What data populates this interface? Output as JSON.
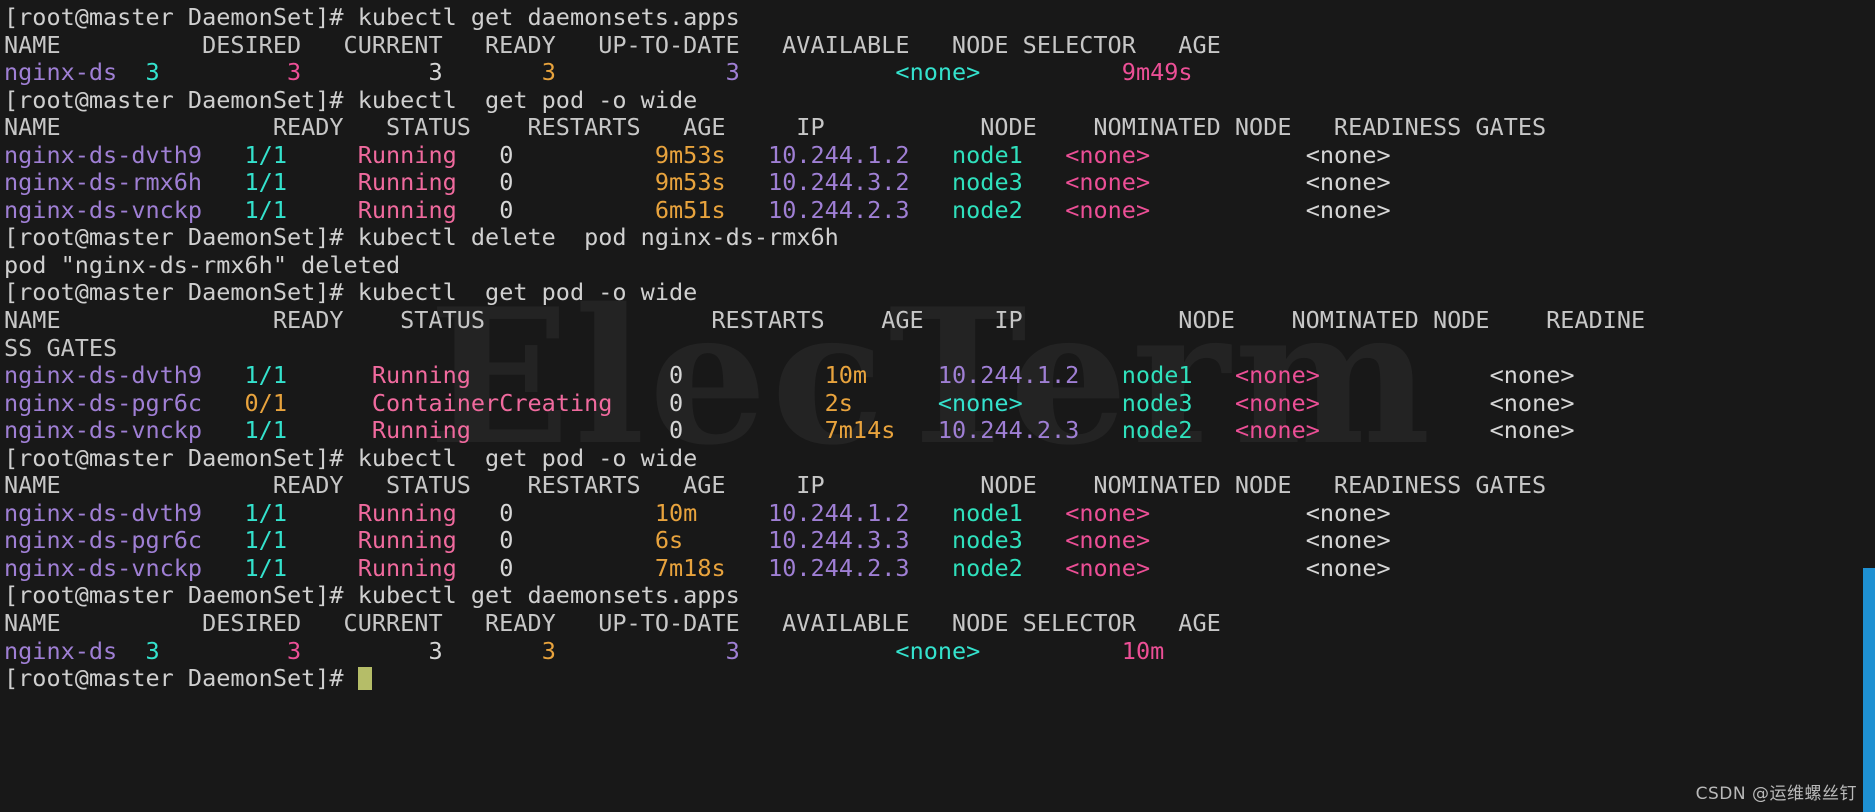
{
  "terminal": {
    "app": "ElecTerm",
    "background_color": "#181818",
    "default_text_color": "#d0d0d0",
    "cursor_color": "#b5bd68",
    "font_size_px": 23.5,
    "colors": {
      "prompt": "#cfcfcf",
      "pod_name": "#9f7fd4",
      "ready_ok": "#34e2cd",
      "ready_pending": "#e8a33d",
      "status_running": "#ec4f96",
      "status_creating": "#ec4f96",
      "age": "#e8a33d",
      "ip": "#9f7fd4",
      "node": "#2fe0bc",
      "nominated_none": "#ec4f96",
      "selector_none": "#34e2cd",
      "ds_age": "#ec4f96",
      "scrollbar": "#1e90d2"
    },
    "prompt": "[root@master DaemonSet]# ",
    "watermark_text": "ElecTerm",
    "csdn_watermark": "CSDN @运维螺丝钉"
  },
  "lines": [
    {
      "id": "cmd-get-daemonsets-1",
      "type": "command",
      "spans": [
        {
          "text": "[root@master DaemonSet]# ",
          "class": "c-prompt"
        },
        {
          "text": "kubectl get daemonsets.apps",
          "class": "c-default"
        }
      ]
    },
    {
      "id": "ds-header-1",
      "type": "header",
      "spans": [
        {
          "text": "NAME          DESIRED   CURRENT   READY   UP-TO-DATE   AVAILABLE   NODE SELECTOR   AGE",
          "class": "c-grey"
        }
      ]
    },
    {
      "id": "ds-row-1",
      "type": "row",
      "spans": [
        {
          "text": "nginx-ds",
          "class": "c-violet"
        },
        {
          "text": "  ",
          "class": "c-default"
        },
        {
          "text": "3",
          "class": "c-cyan"
        },
        {
          "text": "         ",
          "class": "c-default"
        },
        {
          "text": "3",
          "class": "c-pink"
        },
        {
          "text": "         ",
          "class": "c-default"
        },
        {
          "text": "3",
          "class": "c-white"
        },
        {
          "text": "       ",
          "class": "c-default"
        },
        {
          "text": "3",
          "class": "c-orange"
        },
        {
          "text": "            ",
          "class": "c-default"
        },
        {
          "text": "3",
          "class": "c-violet"
        },
        {
          "text": "           ",
          "class": "c-default"
        },
        {
          "text": "<none>",
          "class": "c-cyan"
        },
        {
          "text": "          ",
          "class": "c-default"
        },
        {
          "text": "9m49s",
          "class": "c-pink"
        }
      ]
    },
    {
      "id": "cmd-get-pod-wide-1",
      "type": "command",
      "spans": [
        {
          "text": "[root@master DaemonSet]# ",
          "class": "c-prompt"
        },
        {
          "text": "kubectl  get pod -o wide",
          "class": "c-default"
        }
      ]
    },
    {
      "id": "pod-header-1",
      "type": "header",
      "spans": [
        {
          "text": "NAME               READY   STATUS    RESTARTS   AGE     IP           NODE    NOMINATED NODE   READINESS GATES",
          "class": "c-grey"
        }
      ]
    },
    {
      "id": "pod-row-dvth9-1",
      "type": "row",
      "spans": [
        {
          "text": "nginx-ds-dvth9",
          "class": "c-violet"
        },
        {
          "text": "   ",
          "class": "c-default"
        },
        {
          "text": "1/1",
          "class": "c-cyan"
        },
        {
          "text": "     ",
          "class": "c-default"
        },
        {
          "text": "Running",
          "class": "c-pink2"
        },
        {
          "text": "   ",
          "class": "c-default"
        },
        {
          "text": "0",
          "class": "c-white"
        },
        {
          "text": "          ",
          "class": "c-default"
        },
        {
          "text": "9m53s",
          "class": "c-orange"
        },
        {
          "text": "   ",
          "class": "c-default"
        },
        {
          "text": "10.244.1.2",
          "class": "c-violet"
        },
        {
          "text": "   ",
          "class": "c-default"
        },
        {
          "text": "node1",
          "class": "c-teal"
        },
        {
          "text": "   ",
          "class": "c-default"
        },
        {
          "text": "<none>",
          "class": "c-pink"
        },
        {
          "text": "           ",
          "class": "c-default"
        },
        {
          "text": "<none>",
          "class": "c-white"
        }
      ]
    },
    {
      "id": "pod-row-rmx6h-1",
      "type": "row",
      "spans": [
        {
          "text": "nginx-ds-rmx6h",
          "class": "c-violet"
        },
        {
          "text": "   ",
          "class": "c-default"
        },
        {
          "text": "1/1",
          "class": "c-cyan"
        },
        {
          "text": "     ",
          "class": "c-default"
        },
        {
          "text": "Running",
          "class": "c-pink2"
        },
        {
          "text": "   ",
          "class": "c-default"
        },
        {
          "text": "0",
          "class": "c-white"
        },
        {
          "text": "          ",
          "class": "c-default"
        },
        {
          "text": "9m53s",
          "class": "c-orange"
        },
        {
          "text": "   ",
          "class": "c-default"
        },
        {
          "text": "10.244.3.2",
          "class": "c-violet"
        },
        {
          "text": "   ",
          "class": "c-default"
        },
        {
          "text": "node3",
          "class": "c-teal"
        },
        {
          "text": "   ",
          "class": "c-default"
        },
        {
          "text": "<none>",
          "class": "c-pink"
        },
        {
          "text": "           ",
          "class": "c-default"
        },
        {
          "text": "<none>",
          "class": "c-white"
        }
      ]
    },
    {
      "id": "pod-row-vnckp-1",
      "type": "row",
      "spans": [
        {
          "text": "nginx-ds-vnckp",
          "class": "c-violet"
        },
        {
          "text": "   ",
          "class": "c-default"
        },
        {
          "text": "1/1",
          "class": "c-cyan"
        },
        {
          "text": "     ",
          "class": "c-default"
        },
        {
          "text": "Running",
          "class": "c-pink2"
        },
        {
          "text": "   ",
          "class": "c-default"
        },
        {
          "text": "0",
          "class": "c-white"
        },
        {
          "text": "          ",
          "class": "c-default"
        },
        {
          "text": "6m51s",
          "class": "c-orange"
        },
        {
          "text": "   ",
          "class": "c-default"
        },
        {
          "text": "10.244.2.3",
          "class": "c-violet"
        },
        {
          "text": "   ",
          "class": "c-default"
        },
        {
          "text": "node2",
          "class": "c-teal"
        },
        {
          "text": "   ",
          "class": "c-default"
        },
        {
          "text": "<none>",
          "class": "c-pink"
        },
        {
          "text": "           ",
          "class": "c-default"
        },
        {
          "text": "<none>",
          "class": "c-white"
        }
      ]
    },
    {
      "id": "cmd-delete-pod",
      "type": "command",
      "spans": [
        {
          "text": "[root@master DaemonSet]# ",
          "class": "c-prompt"
        },
        {
          "text": "kubectl delete  pod nginx-ds-rmx6h",
          "class": "c-default"
        }
      ]
    },
    {
      "id": "out-pod-deleted",
      "type": "output",
      "spans": [
        {
          "text": "pod \"nginx-ds-rmx6h\" deleted",
          "class": "c-default"
        }
      ]
    },
    {
      "id": "cmd-get-pod-wide-2",
      "type": "command",
      "spans": [
        {
          "text": "[root@master DaemonSet]# ",
          "class": "c-prompt"
        },
        {
          "text": "kubectl  get pod -o wide",
          "class": "c-default"
        }
      ]
    },
    {
      "id": "pod-header-2a",
      "type": "header",
      "spans": [
        {
          "text": "NAME               READY    STATUS                RESTARTS    AGE     IP           NODE    NOMINATED NODE    READINE",
          "class": "c-grey"
        }
      ]
    },
    {
      "id": "pod-header-2b",
      "type": "header",
      "spans": [
        {
          "text": "SS GATES",
          "class": "c-grey"
        }
      ]
    },
    {
      "id": "pod-row-dvth9-2",
      "type": "row",
      "spans": [
        {
          "text": "nginx-ds-dvth9",
          "class": "c-violet"
        },
        {
          "text": "   ",
          "class": "c-default"
        },
        {
          "text": "1/1",
          "class": "c-cyan"
        },
        {
          "text": "      ",
          "class": "c-default"
        },
        {
          "text": "Running",
          "class": "c-pink2"
        },
        {
          "text": "              ",
          "class": "c-default"
        },
        {
          "text": "0",
          "class": "c-white"
        },
        {
          "text": "          ",
          "class": "c-default"
        },
        {
          "text": "10m",
          "class": "c-orange"
        },
        {
          "text": "     ",
          "class": "c-default"
        },
        {
          "text": "10.244.1.2",
          "class": "c-violet"
        },
        {
          "text": "   ",
          "class": "c-default"
        },
        {
          "text": "node1",
          "class": "c-teal"
        },
        {
          "text": "   ",
          "class": "c-default"
        },
        {
          "text": "<none>",
          "class": "c-pink"
        },
        {
          "text": "            ",
          "class": "c-default"
        },
        {
          "text": "<none>",
          "class": "c-white"
        }
      ]
    },
    {
      "id": "pod-row-pgr6c-2",
      "type": "row",
      "spans": [
        {
          "text": "nginx-ds-pgr6c",
          "class": "c-violet"
        },
        {
          "text": "   ",
          "class": "c-default"
        },
        {
          "text": "0/1",
          "class": "c-orange"
        },
        {
          "text": "      ",
          "class": "c-default"
        },
        {
          "text": "ContainerCreating",
          "class": "c-pink2"
        },
        {
          "text": "    ",
          "class": "c-default"
        },
        {
          "text": "0",
          "class": "c-white"
        },
        {
          "text": "          ",
          "class": "c-default"
        },
        {
          "text": "2s",
          "class": "c-orange"
        },
        {
          "text": "      ",
          "class": "c-default"
        },
        {
          "text": "<none>",
          "class": "c-cyan"
        },
        {
          "text": "       ",
          "class": "c-default"
        },
        {
          "text": "node3",
          "class": "c-teal"
        },
        {
          "text": "   ",
          "class": "c-default"
        },
        {
          "text": "<none>",
          "class": "c-pink"
        },
        {
          "text": "            ",
          "class": "c-default"
        },
        {
          "text": "<none>",
          "class": "c-white"
        }
      ]
    },
    {
      "id": "pod-row-vnckp-2",
      "type": "row",
      "spans": [
        {
          "text": "nginx-ds-vnckp",
          "class": "c-violet"
        },
        {
          "text": "   ",
          "class": "c-default"
        },
        {
          "text": "1/1",
          "class": "c-cyan"
        },
        {
          "text": "      ",
          "class": "c-default"
        },
        {
          "text": "Running",
          "class": "c-pink2"
        },
        {
          "text": "              ",
          "class": "c-default"
        },
        {
          "text": "0",
          "class": "c-white"
        },
        {
          "text": "          ",
          "class": "c-default"
        },
        {
          "text": "7m14s",
          "class": "c-orange"
        },
        {
          "text": "   ",
          "class": "c-default"
        },
        {
          "text": "10.244.2.3",
          "class": "c-violet"
        },
        {
          "text": "   ",
          "class": "c-default"
        },
        {
          "text": "node2",
          "class": "c-teal"
        },
        {
          "text": "   ",
          "class": "c-default"
        },
        {
          "text": "<none>",
          "class": "c-pink"
        },
        {
          "text": "            ",
          "class": "c-default"
        },
        {
          "text": "<none>",
          "class": "c-white"
        }
      ]
    },
    {
      "id": "cmd-get-pod-wide-3",
      "type": "command",
      "spans": [
        {
          "text": "[root@master DaemonSet]# ",
          "class": "c-prompt"
        },
        {
          "text": "kubectl  get pod -o wide",
          "class": "c-default"
        }
      ]
    },
    {
      "id": "pod-header-3",
      "type": "header",
      "spans": [
        {
          "text": "NAME               READY   STATUS    RESTARTS   AGE     IP           NODE    NOMINATED NODE   READINESS GATES",
          "class": "c-grey"
        }
      ]
    },
    {
      "id": "pod-row-dvth9-3",
      "type": "row",
      "spans": [
        {
          "text": "nginx-ds-dvth9",
          "class": "c-violet"
        },
        {
          "text": "   ",
          "class": "c-default"
        },
        {
          "text": "1/1",
          "class": "c-cyan"
        },
        {
          "text": "     ",
          "class": "c-default"
        },
        {
          "text": "Running",
          "class": "c-pink2"
        },
        {
          "text": "   ",
          "class": "c-default"
        },
        {
          "text": "0",
          "class": "c-white"
        },
        {
          "text": "          ",
          "class": "c-default"
        },
        {
          "text": "10m",
          "class": "c-orange"
        },
        {
          "text": "     ",
          "class": "c-default"
        },
        {
          "text": "10.244.1.2",
          "class": "c-violet"
        },
        {
          "text": "   ",
          "class": "c-default"
        },
        {
          "text": "node1",
          "class": "c-teal"
        },
        {
          "text": "   ",
          "class": "c-default"
        },
        {
          "text": "<none>",
          "class": "c-pink"
        },
        {
          "text": "           ",
          "class": "c-default"
        },
        {
          "text": "<none>",
          "class": "c-white"
        }
      ]
    },
    {
      "id": "pod-row-pgr6c-3",
      "type": "row",
      "spans": [
        {
          "text": "nginx-ds-pgr6c",
          "class": "c-violet"
        },
        {
          "text": "   ",
          "class": "c-default"
        },
        {
          "text": "1/1",
          "class": "c-cyan"
        },
        {
          "text": "     ",
          "class": "c-default"
        },
        {
          "text": "Running",
          "class": "c-pink2"
        },
        {
          "text": "   ",
          "class": "c-default"
        },
        {
          "text": "0",
          "class": "c-white"
        },
        {
          "text": "          ",
          "class": "c-default"
        },
        {
          "text": "6s",
          "class": "c-orange"
        },
        {
          "text": "      ",
          "class": "c-default"
        },
        {
          "text": "10.244.3.3",
          "class": "c-violet"
        },
        {
          "text": "   ",
          "class": "c-default"
        },
        {
          "text": "node3",
          "class": "c-teal"
        },
        {
          "text": "   ",
          "class": "c-default"
        },
        {
          "text": "<none>",
          "class": "c-pink"
        },
        {
          "text": "           ",
          "class": "c-default"
        },
        {
          "text": "<none>",
          "class": "c-white"
        }
      ]
    },
    {
      "id": "pod-row-vnckp-3",
      "type": "row",
      "spans": [
        {
          "text": "nginx-ds-vnckp",
          "class": "c-violet"
        },
        {
          "text": "   ",
          "class": "c-default"
        },
        {
          "text": "1/1",
          "class": "c-cyan"
        },
        {
          "text": "     ",
          "class": "c-default"
        },
        {
          "text": "Running",
          "class": "c-pink2"
        },
        {
          "text": "   ",
          "class": "c-default"
        },
        {
          "text": "0",
          "class": "c-white"
        },
        {
          "text": "          ",
          "class": "c-default"
        },
        {
          "text": "7m18s",
          "class": "c-orange"
        },
        {
          "text": "   ",
          "class": "c-default"
        },
        {
          "text": "10.244.2.3",
          "class": "c-violet"
        },
        {
          "text": "   ",
          "class": "c-default"
        },
        {
          "text": "node2",
          "class": "c-teal"
        },
        {
          "text": "   ",
          "class": "c-default"
        },
        {
          "text": "<none>",
          "class": "c-pink"
        },
        {
          "text": "           ",
          "class": "c-default"
        },
        {
          "text": "<none>",
          "class": "c-white"
        }
      ]
    },
    {
      "id": "cmd-get-daemonsets-2",
      "type": "command",
      "spans": [
        {
          "text": "[root@master DaemonSet]# ",
          "class": "c-prompt"
        },
        {
          "text": "kubectl get daemonsets.apps",
          "class": "c-default"
        }
      ]
    },
    {
      "id": "ds-header-2",
      "type": "header",
      "spans": [
        {
          "text": "NAME          DESIRED   CURRENT   READY   UP-TO-DATE   AVAILABLE   NODE SELECTOR   AGE",
          "class": "c-grey"
        }
      ]
    },
    {
      "id": "ds-row-2",
      "type": "row",
      "spans": [
        {
          "text": "nginx-ds",
          "class": "c-violet"
        },
        {
          "text": "  ",
          "class": "c-default"
        },
        {
          "text": "3",
          "class": "c-cyan"
        },
        {
          "text": "         ",
          "class": "c-default"
        },
        {
          "text": "3",
          "class": "c-pink"
        },
        {
          "text": "         ",
          "class": "c-default"
        },
        {
          "text": "3",
          "class": "c-white"
        },
        {
          "text": "       ",
          "class": "c-default"
        },
        {
          "text": "3",
          "class": "c-orange"
        },
        {
          "text": "            ",
          "class": "c-default"
        },
        {
          "text": "3",
          "class": "c-violet"
        },
        {
          "text": "           ",
          "class": "c-default"
        },
        {
          "text": "<none>",
          "class": "c-cyan"
        },
        {
          "text": "          ",
          "class": "c-default"
        },
        {
          "text": "10m",
          "class": "c-pink"
        }
      ]
    },
    {
      "id": "cmd-prompt-active",
      "type": "prompt",
      "cursor": true,
      "spans": [
        {
          "text": "[root@master DaemonSet]# ",
          "class": "c-prompt"
        }
      ]
    }
  ]
}
